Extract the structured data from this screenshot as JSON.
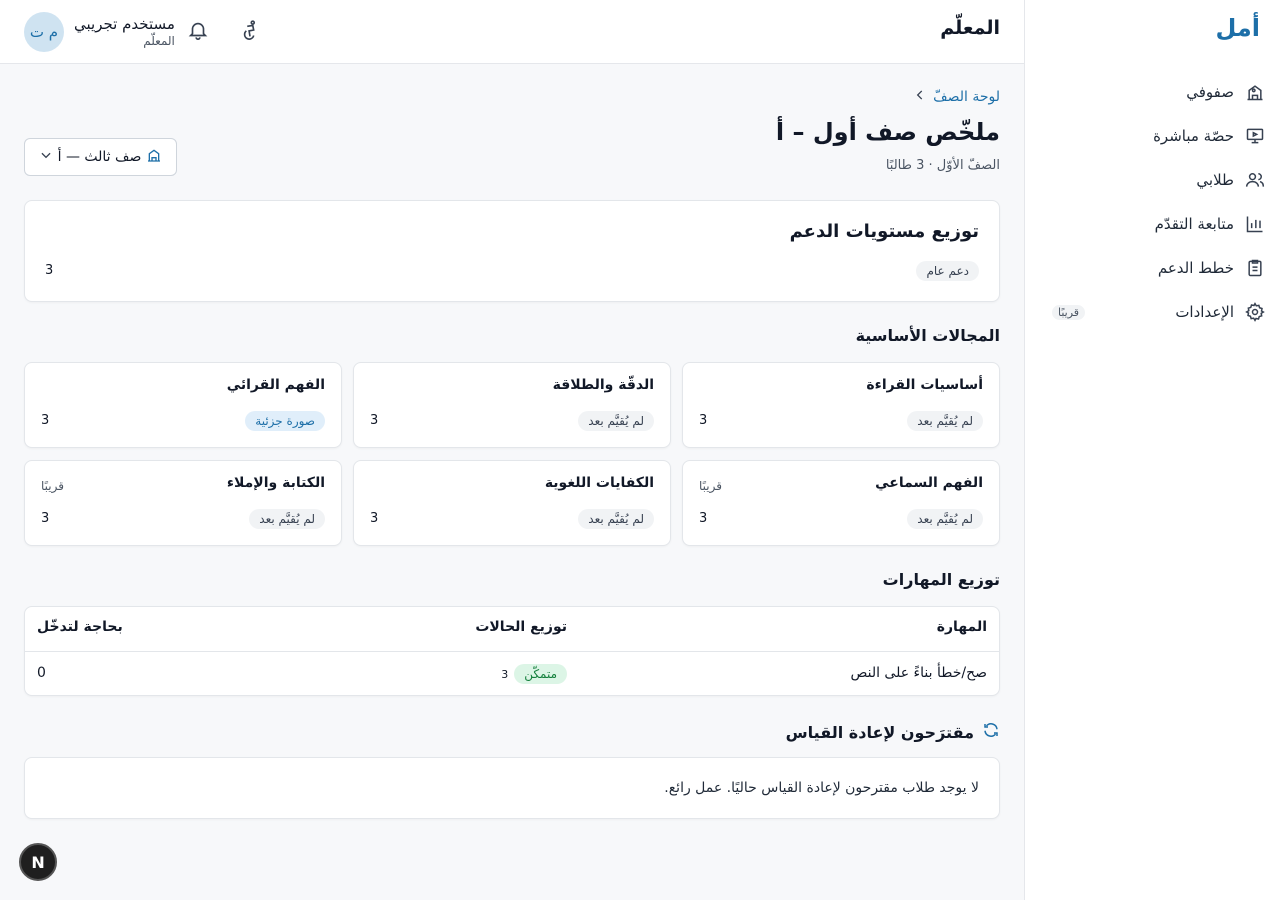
{
  "app": {
    "logo": "أمل"
  },
  "sidebar": {
    "items": [
      {
        "label": "صفوفي",
        "icon": "school-icon"
      },
      {
        "label": "حصّة مباشرة",
        "icon": "presentation-icon"
      },
      {
        "label": "طلابي",
        "icon": "users-icon"
      },
      {
        "label": "متابعة التقدّم",
        "icon": "bar-chart-icon"
      },
      {
        "label": "خطط الدعم",
        "icon": "clipboard-list-icon"
      },
      {
        "label": "الإعدادات",
        "icon": "gear-icon",
        "badge": "قريبًا"
      }
    ]
  },
  "header": {
    "title": "المعلّم",
    "user": {
      "initials": "م ت",
      "name": "مستخدم تجريبي",
      "role": "المعلّم"
    }
  },
  "breadcrumb": {
    "label": "لوحة الصفّ"
  },
  "page": {
    "title": "ملخّص صف أول – أ",
    "subtitle": "الصفّ الأوّل · 3 طالبًا",
    "class_select": "صف ثالث — أ"
  },
  "support_distribution": {
    "title": "توزيع مستويات الدعم",
    "level": "دعم عام",
    "count": "3"
  },
  "domains_section": {
    "title": "المجالات الأساسية",
    "items": [
      {
        "title": "أساسيات القراءة",
        "status": "لم يُقيَّم بعد",
        "count": "3",
        "soon": ""
      },
      {
        "title": "الدقّة والطلاقة",
        "status": "لم يُقيَّم بعد",
        "count": "3",
        "soon": ""
      },
      {
        "title": "الفهم القرائي",
        "status": "صورة جزئية",
        "count": "3",
        "soon": ""
      },
      {
        "title": "الفهم السماعي",
        "status": "لم يُقيَّم بعد",
        "count": "3",
        "soon": "قريبًا"
      },
      {
        "title": "الكفايات اللغوية",
        "status": "لم يُقيَّم بعد",
        "count": "3",
        "soon": ""
      },
      {
        "title": "الكتابة والإملاء",
        "status": "لم يُقيَّم بعد",
        "count": "3",
        "soon": "قريبًا"
      }
    ]
  },
  "skills": {
    "title": "توزيع المهارات",
    "columns": {
      "skill": "المهارة",
      "distribution": "توزيع الحالات",
      "intervention": "بحاجة لتدخّل"
    },
    "rows": [
      {
        "skill": "صح/خطأ بناءً على النص",
        "status": "متمكّن",
        "status_count": "3",
        "intervention": "0"
      }
    ]
  },
  "remeasure": {
    "title": "مقترَحون لإعادة القياس",
    "message": "لا يوجد طلاب مقترحون لإعادة القياس حاليًا. عمل رائع."
  },
  "fab": {
    "label": "N"
  },
  "colors": {
    "brand": "#1d6fa8",
    "mastered_bg": "#dcf5e6",
    "mastered_text": "#15803d"
  }
}
